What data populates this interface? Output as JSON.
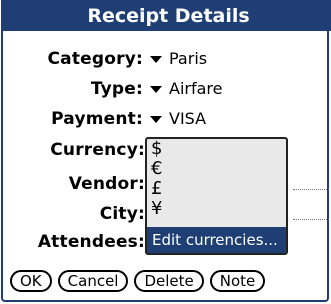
{
  "title": "Receipt Details",
  "fields": [
    {
      "label": "Category:",
      "value": "Paris"
    },
    {
      "label": "Type:",
      "value": "Airfare"
    },
    {
      "label": "Payment:",
      "value": "VISA"
    },
    {
      "label": "Currency:"
    },
    {
      "label": "Vendor:"
    },
    {
      "label": "City:"
    },
    {
      "label": "Attendees:"
    }
  ],
  "currency_list": {
    "items": [
      "$",
      "€",
      "£",
      "¥"
    ],
    "selected": "Edit currencies..."
  },
  "buttons": [
    "OK",
    "Cancel",
    "Delete",
    "Note"
  ],
  "colors": {
    "accent": "#1f3f74",
    "list_bg": "#e9e9e9"
  },
  "icons": {
    "popup_trigger": "triangle-down-icon"
  }
}
